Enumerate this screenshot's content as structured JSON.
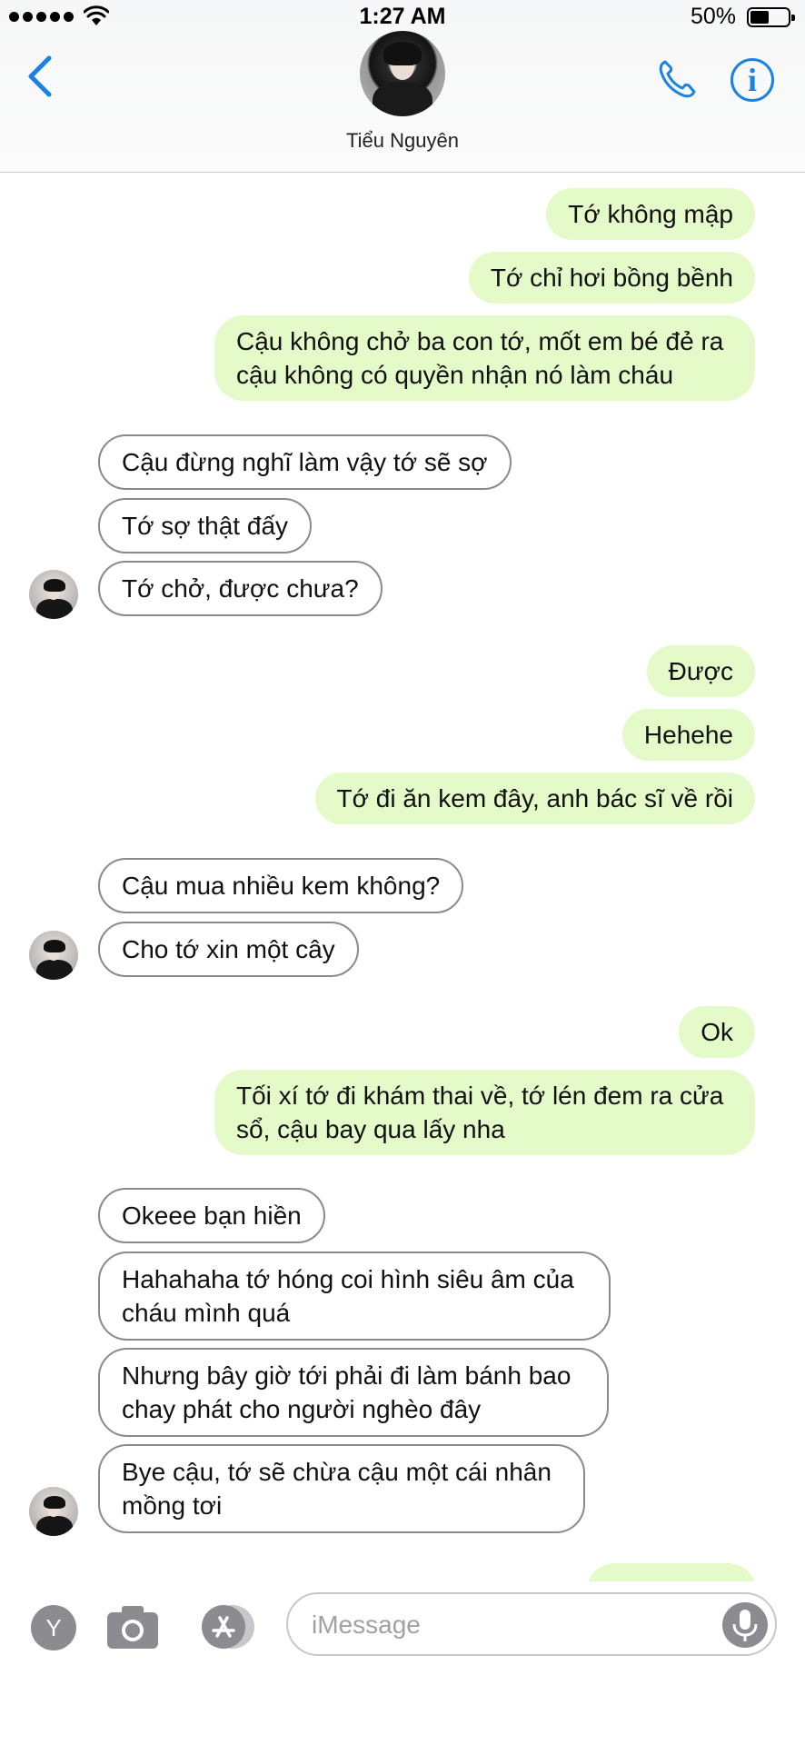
{
  "status_bar": {
    "time": "1:27 AM",
    "battery_percent": "50%",
    "battery_level": 0.5,
    "icons": [
      "signal-dots-icon",
      "wifi-icon",
      "battery-icon"
    ]
  },
  "header": {
    "contact_name": "Tiểu Nguyên",
    "icons": [
      "back-chevron-icon",
      "phone-icon",
      "info-icon"
    ],
    "accent_color": "#1a82e2"
  },
  "messages": [
    {
      "side": "sent",
      "text": "Tớ không mập"
    },
    {
      "side": "sent",
      "text": "Tớ chỉ hơi bồng bềnh"
    },
    {
      "side": "sent",
      "text": "Cậu không chở ba con tớ, mốt em bé đẻ ra cậu không có quyền nhận nó làm cháu"
    },
    {
      "side": "received",
      "text": "Cậu đừng nghĩ làm vậy tớ sẽ sợ"
    },
    {
      "side": "received",
      "text": "Tớ sợ thật đấy"
    },
    {
      "side": "received",
      "text": "Tớ chở, được chưa?"
    },
    {
      "side": "sent",
      "text": "Được"
    },
    {
      "side": "sent",
      "text": "Hehehe"
    },
    {
      "side": "sent",
      "text": "Tớ đi ăn kem đây, anh bác sĩ về rồi"
    },
    {
      "side": "received",
      "text": "Cậu mua nhiều kem không?"
    },
    {
      "side": "received",
      "text": "Cho tớ xin một cây"
    },
    {
      "side": "sent",
      "text": "Ok"
    },
    {
      "side": "sent",
      "text": "Tối xí tớ đi khám thai về, tớ lén đem ra cửa sổ, cậu bay qua lấy nha"
    },
    {
      "side": "received",
      "text": "Okeee bạn hiền"
    },
    {
      "side": "received",
      "text": "Hahahaha tớ hóng coi hình siêu âm của cháu mình quá"
    },
    {
      "side": "received",
      "text": "Nhưng bây giờ tới phải đi làm bánh bao chay phát cho người nghèo đây"
    },
    {
      "side": "received",
      "text": "Bye cậu, tớ sẽ chừa cậu một cái nhân mồng tơi"
    }
  ],
  "colors": {
    "sent_bubble": "#e4fac8",
    "received_border": "#8a8a8a"
  },
  "input_bar": {
    "y_button_label": "Y",
    "placeholder": "iMessage",
    "icons": [
      "camera-icon",
      "app-store-icon",
      "microphone-icon"
    ]
  }
}
